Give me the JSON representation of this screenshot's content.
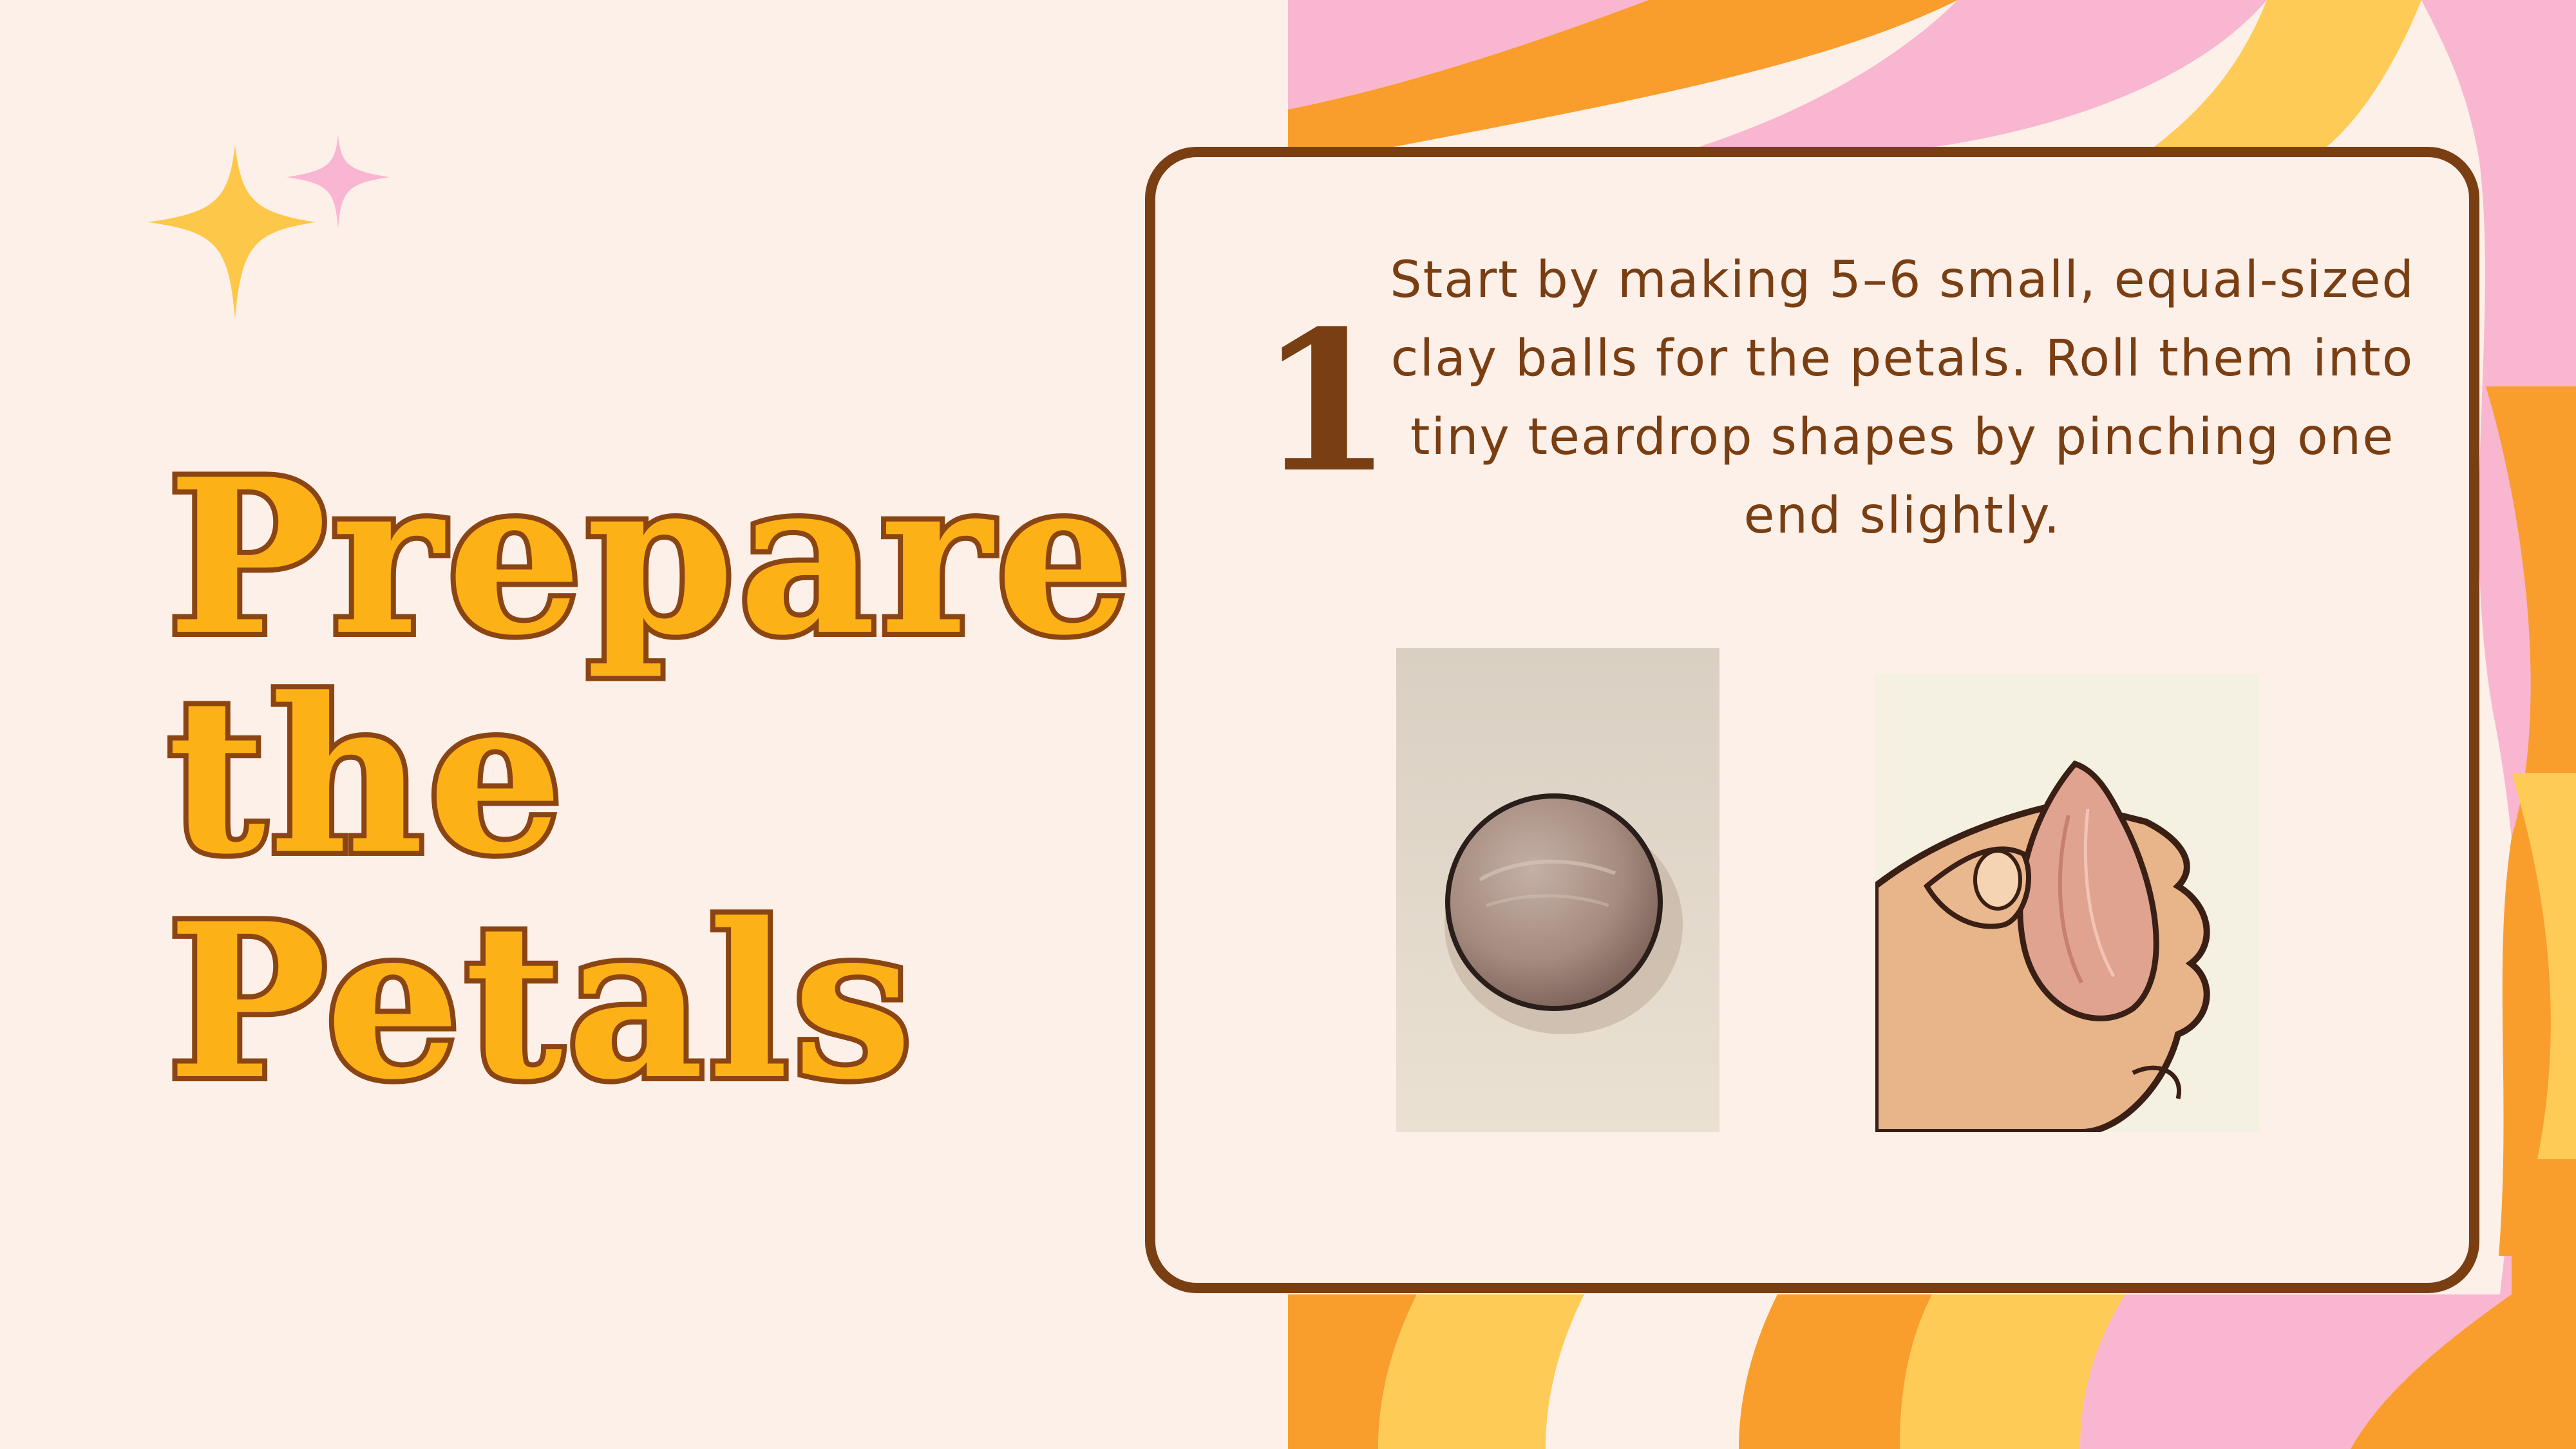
{
  "slide": {
    "title_lines": [
      "Prepare",
      "the",
      "Petals"
    ],
    "step": {
      "number": "1",
      "text": "Start by making 5–6 small, equal-sized clay balls for the petals. Roll them into tiny teardrop shapes by pinching one end slightly."
    },
    "images": [
      {
        "name": "clay-ball-illustration"
      },
      {
        "name": "teardrop-pinch-illustration"
      }
    ]
  },
  "colors": {
    "background": "#fdf0e8",
    "title_fill": "#fcb117",
    "title_outline": "#8b4513",
    "card_border": "#7a3e13",
    "wave_pink": "#f9b6d0",
    "wave_orange": "#f99e2c",
    "wave_yellow": "#fecb56",
    "sparkle_yellow": "#fdc84a",
    "sparkle_pink": "#f8b6d2"
  }
}
